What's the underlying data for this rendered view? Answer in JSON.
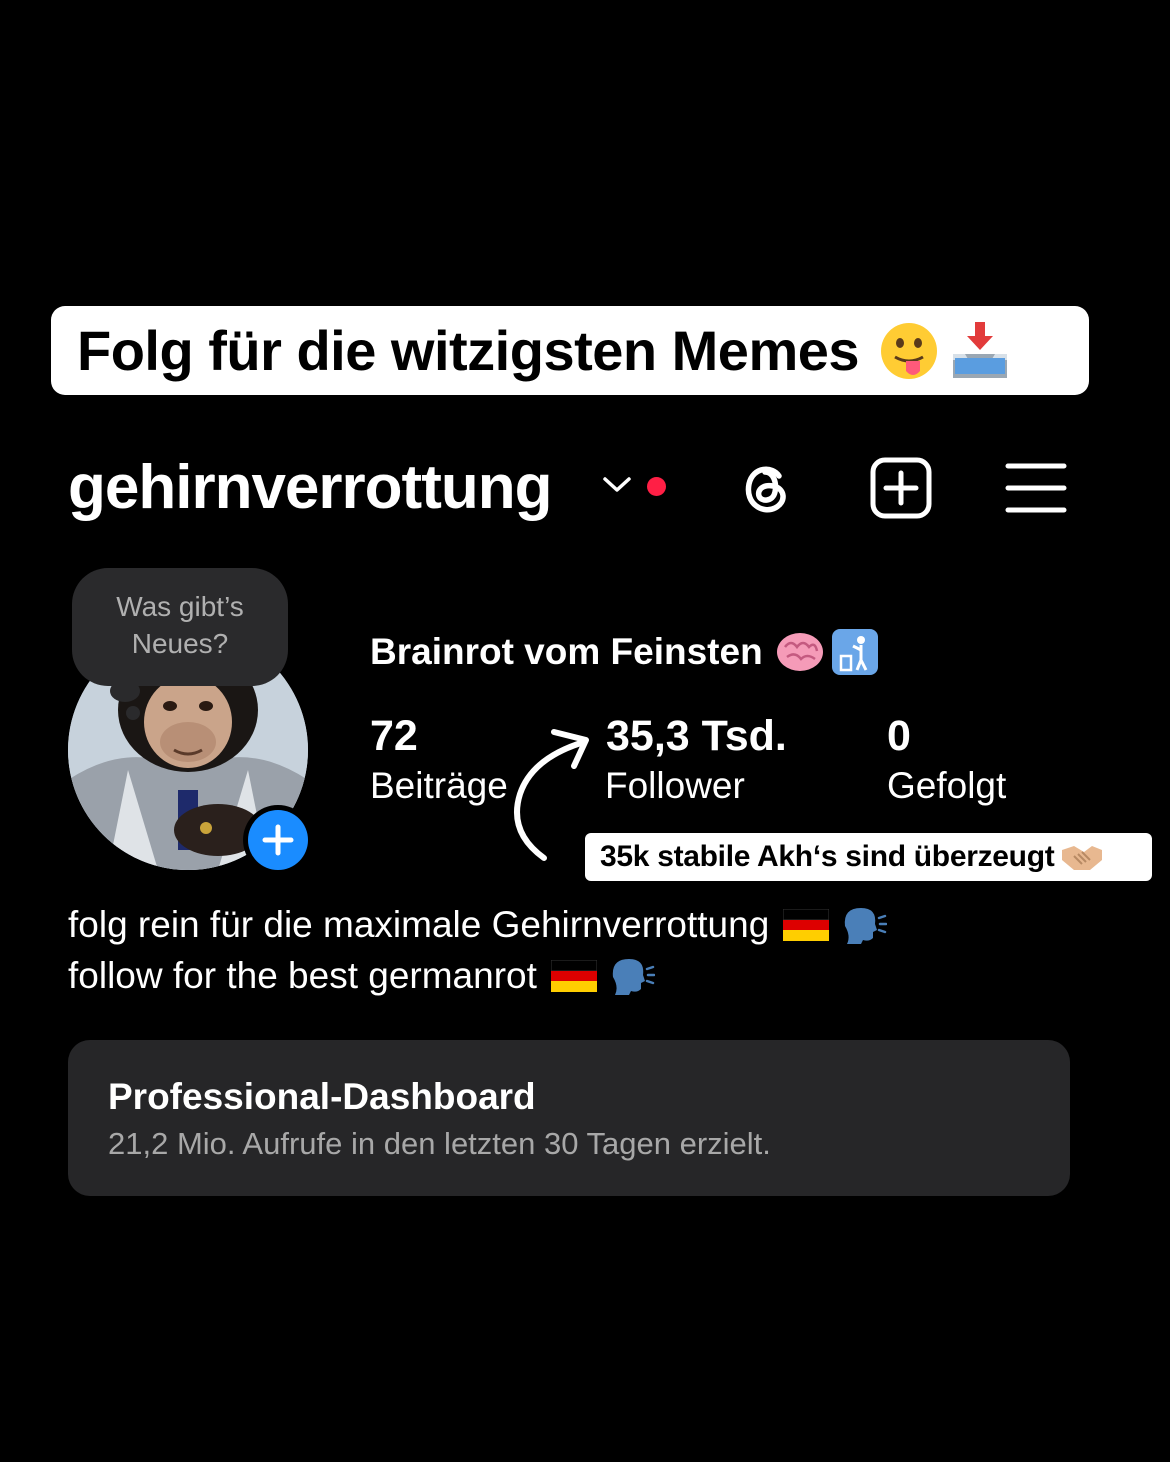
{
  "caption": {
    "text": "Folg für die witzigsten Memes",
    "emojis": [
      "face-with-tongue-icon",
      "inbox-tray-icon"
    ]
  },
  "header": {
    "username": "gehirnverrottung",
    "icons": [
      "chevron-down-icon",
      "threads-icon",
      "add-post-icon",
      "menu-icon"
    ],
    "notification_dot_color": "#ff1f45"
  },
  "note": {
    "text_line1": "Was gibt’s",
    "text_line2": "Neues?"
  },
  "profile": {
    "full_name": "Brainrot vom Feinsten",
    "name_emojis": [
      "brain-icon",
      "litter-in-bin-icon"
    ],
    "avatar_badge": "plus-icon",
    "badge_color": "#1a8cff"
  },
  "stats": [
    {
      "value": "72",
      "label": "Beiträge"
    },
    {
      "value": "35,3 Tsd.",
      "label": "Follower"
    },
    {
      "value": "0",
      "label": "Gefolgt"
    }
  ],
  "sticker": {
    "text": "35k stabile Akh‘s sind überzeugt",
    "emoji": "handshake-icon"
  },
  "bio": {
    "line1": "folg rein für die maximale Gehirnverrottung",
    "line2": "follow for the best germanrot",
    "emojis": [
      "germany-flag-icon",
      "speaking-head-icon"
    ]
  },
  "dashboard": {
    "title": "Professional-Dashboard",
    "subtitle": "21,2 Mio. Aufrufe in den letzten 30 Tagen erzielt."
  }
}
